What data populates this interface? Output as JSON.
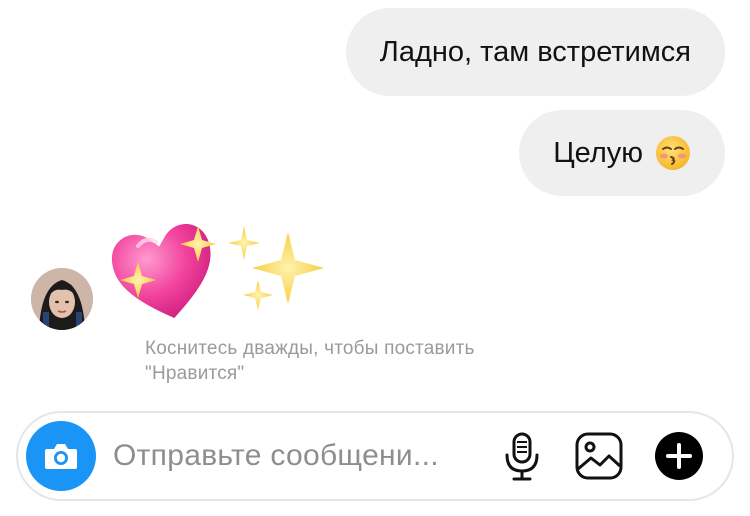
{
  "messages": {
    "outgoing": [
      {
        "text": "Ладно, там встретимся",
        "emoji": ""
      },
      {
        "text": "Целую",
        "emoji": "kissing-closed-eyes-emoji"
      }
    ],
    "incoming": {
      "reaction_emojis": [
        "sparkling-heart-emoji",
        "sparkles-emoji"
      ],
      "hint_line1": "Коснитесь дважды, чтобы поставить",
      "hint_line2": "\"Нравится\""
    }
  },
  "composer": {
    "placeholder": "Отправьте сообщени...",
    "camera_icon": "camera-icon",
    "mic_icon": "microphone-icon",
    "gallery_icon": "gallery-icon",
    "plus_icon": "plus-icon"
  },
  "colors": {
    "bubble_bg": "#efefef",
    "camera_blue": "#1a94f5",
    "hint_gray": "#9a9a9a",
    "heart_pink": "#f2439d",
    "sparkle_gold": "#f7c52b"
  }
}
